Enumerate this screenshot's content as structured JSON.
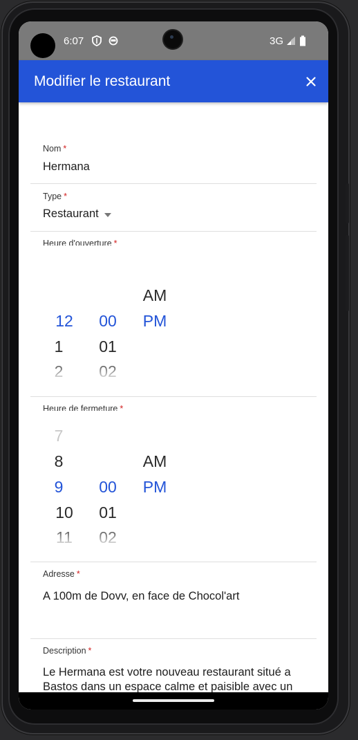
{
  "status_bar": {
    "time": "6:07",
    "network": "3G",
    "icons": [
      "shield-icon",
      "notification-icon",
      "signal-icon",
      "battery-icon"
    ]
  },
  "app_bar": {
    "title": "Modifier le restaurant",
    "close_icon": "close-icon",
    "color": "#2354d8"
  },
  "form": {
    "name": {
      "label": "Nom",
      "required_mark": "*",
      "value": "Hermana"
    },
    "type": {
      "label": "Type",
      "required_mark": "*",
      "value": "Restaurant"
    },
    "opening": {
      "label": "Heure d'ouverture",
      "required_mark": "*",
      "hours": [
        "12",
        "1",
        "2"
      ],
      "minutes": [
        "00",
        "01",
        "02"
      ],
      "periods": [
        "AM",
        "PM"
      ],
      "selected": {
        "hour": "12",
        "minute": "00",
        "period": "PM"
      }
    },
    "closing": {
      "label": "Heure de fermeture",
      "required_mark": "*",
      "hours": [
        "7",
        "8",
        "9",
        "10",
        "11"
      ],
      "minutes": [
        "00",
        "01",
        "02"
      ],
      "periods": [
        "AM",
        "PM"
      ],
      "selected": {
        "hour": "9",
        "minute": "00",
        "period": "PM"
      }
    },
    "address": {
      "label": "Adresse",
      "required_mark": "*",
      "value": "A 100m de Dovv, en face de Chocol'art"
    },
    "description": {
      "label": "Description",
      "required_mark": "*",
      "value": "Le Hermana est votre nouveau restaurant situé a Bastos dans un espace calme et paisible avec un menu traditionnelle et varié"
    }
  },
  "colors": {
    "accent": "#2354d8",
    "required": "#d21f1f"
  }
}
